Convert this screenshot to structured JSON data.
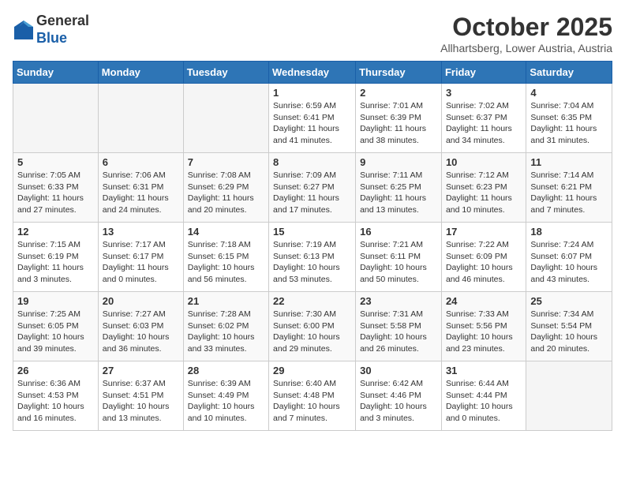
{
  "header": {
    "logo_line1": "General",
    "logo_line2": "Blue",
    "month": "October 2025",
    "location": "Allhartsberg, Lower Austria, Austria"
  },
  "days_of_week": [
    "Sunday",
    "Monday",
    "Tuesday",
    "Wednesday",
    "Thursday",
    "Friday",
    "Saturday"
  ],
  "weeks": [
    [
      {
        "day": "",
        "info": ""
      },
      {
        "day": "",
        "info": ""
      },
      {
        "day": "",
        "info": ""
      },
      {
        "day": "1",
        "info": "Sunrise: 6:59 AM\nSunset: 6:41 PM\nDaylight: 11 hours and 41 minutes."
      },
      {
        "day": "2",
        "info": "Sunrise: 7:01 AM\nSunset: 6:39 PM\nDaylight: 11 hours and 38 minutes."
      },
      {
        "day": "3",
        "info": "Sunrise: 7:02 AM\nSunset: 6:37 PM\nDaylight: 11 hours and 34 minutes."
      },
      {
        "day": "4",
        "info": "Sunrise: 7:04 AM\nSunset: 6:35 PM\nDaylight: 11 hours and 31 minutes."
      }
    ],
    [
      {
        "day": "5",
        "info": "Sunrise: 7:05 AM\nSunset: 6:33 PM\nDaylight: 11 hours and 27 minutes."
      },
      {
        "day": "6",
        "info": "Sunrise: 7:06 AM\nSunset: 6:31 PM\nDaylight: 11 hours and 24 minutes."
      },
      {
        "day": "7",
        "info": "Sunrise: 7:08 AM\nSunset: 6:29 PM\nDaylight: 11 hours and 20 minutes."
      },
      {
        "day": "8",
        "info": "Sunrise: 7:09 AM\nSunset: 6:27 PM\nDaylight: 11 hours and 17 minutes."
      },
      {
        "day": "9",
        "info": "Sunrise: 7:11 AM\nSunset: 6:25 PM\nDaylight: 11 hours and 13 minutes."
      },
      {
        "day": "10",
        "info": "Sunrise: 7:12 AM\nSunset: 6:23 PM\nDaylight: 11 hours and 10 minutes."
      },
      {
        "day": "11",
        "info": "Sunrise: 7:14 AM\nSunset: 6:21 PM\nDaylight: 11 hours and 7 minutes."
      }
    ],
    [
      {
        "day": "12",
        "info": "Sunrise: 7:15 AM\nSunset: 6:19 PM\nDaylight: 11 hours and 3 minutes."
      },
      {
        "day": "13",
        "info": "Sunrise: 7:17 AM\nSunset: 6:17 PM\nDaylight: 11 hours and 0 minutes."
      },
      {
        "day": "14",
        "info": "Sunrise: 7:18 AM\nSunset: 6:15 PM\nDaylight: 10 hours and 56 minutes."
      },
      {
        "day": "15",
        "info": "Sunrise: 7:19 AM\nSunset: 6:13 PM\nDaylight: 10 hours and 53 minutes."
      },
      {
        "day": "16",
        "info": "Sunrise: 7:21 AM\nSunset: 6:11 PM\nDaylight: 10 hours and 50 minutes."
      },
      {
        "day": "17",
        "info": "Sunrise: 7:22 AM\nSunset: 6:09 PM\nDaylight: 10 hours and 46 minutes."
      },
      {
        "day": "18",
        "info": "Sunrise: 7:24 AM\nSunset: 6:07 PM\nDaylight: 10 hours and 43 minutes."
      }
    ],
    [
      {
        "day": "19",
        "info": "Sunrise: 7:25 AM\nSunset: 6:05 PM\nDaylight: 10 hours and 39 minutes."
      },
      {
        "day": "20",
        "info": "Sunrise: 7:27 AM\nSunset: 6:03 PM\nDaylight: 10 hours and 36 minutes."
      },
      {
        "day": "21",
        "info": "Sunrise: 7:28 AM\nSunset: 6:02 PM\nDaylight: 10 hours and 33 minutes."
      },
      {
        "day": "22",
        "info": "Sunrise: 7:30 AM\nSunset: 6:00 PM\nDaylight: 10 hours and 29 minutes."
      },
      {
        "day": "23",
        "info": "Sunrise: 7:31 AM\nSunset: 5:58 PM\nDaylight: 10 hours and 26 minutes."
      },
      {
        "day": "24",
        "info": "Sunrise: 7:33 AM\nSunset: 5:56 PM\nDaylight: 10 hours and 23 minutes."
      },
      {
        "day": "25",
        "info": "Sunrise: 7:34 AM\nSunset: 5:54 PM\nDaylight: 10 hours and 20 minutes."
      }
    ],
    [
      {
        "day": "26",
        "info": "Sunrise: 6:36 AM\nSunset: 4:53 PM\nDaylight: 10 hours and 16 minutes."
      },
      {
        "day": "27",
        "info": "Sunrise: 6:37 AM\nSunset: 4:51 PM\nDaylight: 10 hours and 13 minutes."
      },
      {
        "day": "28",
        "info": "Sunrise: 6:39 AM\nSunset: 4:49 PM\nDaylight: 10 hours and 10 minutes."
      },
      {
        "day": "29",
        "info": "Sunrise: 6:40 AM\nSunset: 4:48 PM\nDaylight: 10 hours and 7 minutes."
      },
      {
        "day": "30",
        "info": "Sunrise: 6:42 AM\nSunset: 4:46 PM\nDaylight: 10 hours and 3 minutes."
      },
      {
        "day": "31",
        "info": "Sunrise: 6:44 AM\nSunset: 4:44 PM\nDaylight: 10 hours and 0 minutes."
      },
      {
        "day": "",
        "info": ""
      }
    ]
  ]
}
